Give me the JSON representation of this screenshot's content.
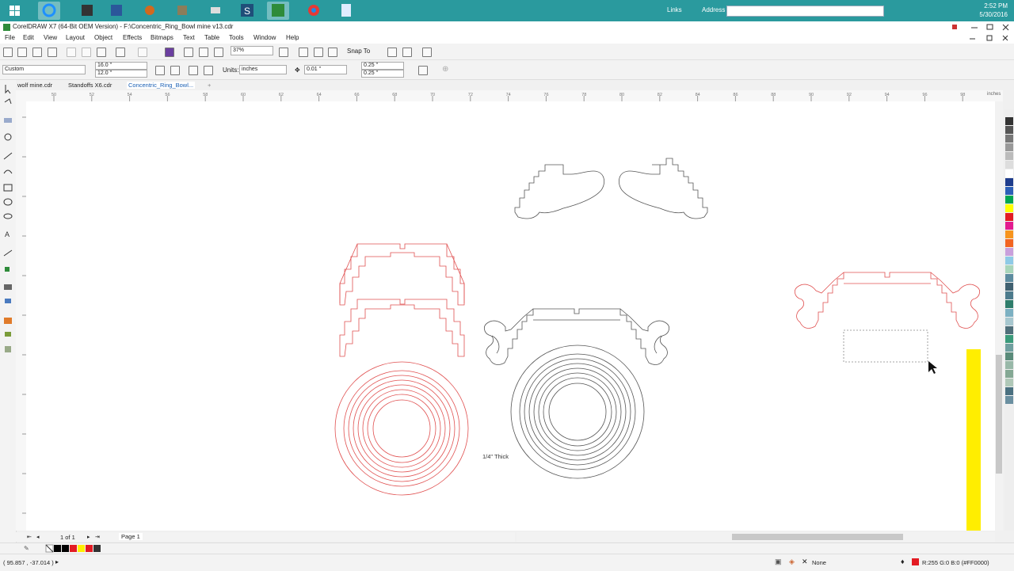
{
  "taskbar": {
    "links_label": "Links",
    "address_label": "Address",
    "clock_time": "2:52 PM",
    "clock_date": "5/30/2016"
  },
  "window": {
    "title": "CorelDRAW X7 (64-Bit OEM Version) - F:\\Concentric_Ring_Bowl mine v13.cdr"
  },
  "menu": [
    "File",
    "Edit",
    "View",
    "Layout",
    "Object",
    "Effects",
    "Bitmaps",
    "Text",
    "Table",
    "Tools",
    "Window",
    "Help"
  ],
  "toolbar": {
    "zoom": "37%",
    "snap_to": "Snap To"
  },
  "property_bar": {
    "page_preset": "Custom",
    "width": "16.0 \"",
    "height": "12.0 \"",
    "units_label": "Units:",
    "units": "inches",
    "nudge": "0.01 \"",
    "dup_x": "0.25 \"",
    "dup_y": "0.25 \""
  },
  "doc_tabs": [
    "wolf mine.cdr",
    "Standoffs X6.cdr",
    "Concentric_Ring_Bowl..."
  ],
  "ruler": {
    "labels": [
      "50",
      "52",
      "54",
      "56",
      "58",
      "60",
      "62",
      "64",
      "66",
      "68",
      "70",
      "72",
      "74",
      "76",
      "78",
      "80",
      "82",
      "84",
      "86",
      "88",
      "90",
      "92",
      "94",
      "96",
      "98"
    ],
    "unit": "inches"
  },
  "canvas": {
    "thickness_note": "1/4\" Thick"
  },
  "page_nav": {
    "count": "1 of 1",
    "page_tab": "Page 1"
  },
  "status": {
    "cursor_pos": "( 95.857 , -37.014 )",
    "fill_none": "None",
    "outline_color": "R:255 G:0 B:0 (#FF0000)"
  },
  "colors": {
    "red_outline": "#e05050",
    "black_outline": "#555555",
    "selection_yellow": "#ffee00",
    "taskbar": "#2a9a9e"
  },
  "palette": [
    "#333333",
    "#555555",
    "#777777",
    "#999999",
    "#bbbbbb",
    "#dddddd",
    "#ffffff",
    "#1e3c8c",
    "#2c5fb7",
    "#00a651",
    "#ffff00",
    "#e31b23",
    "#e31b8f",
    "#f7941d",
    "#f26522",
    "#c9a0dc",
    "#8ecae6",
    "#a8d5ba",
    "#5c8b9f",
    "#406070",
    "#4c7a8c",
    "#2e7d6b",
    "#7cb0c2",
    "#a7c7cf",
    "#4f6f7a",
    "#3a9a7a",
    "#6f9f9f",
    "#5a8b7a",
    "#98b8a8",
    "#84a894",
    "#b0c8b8",
    "#4a7080",
    "#6a8fa0"
  ]
}
